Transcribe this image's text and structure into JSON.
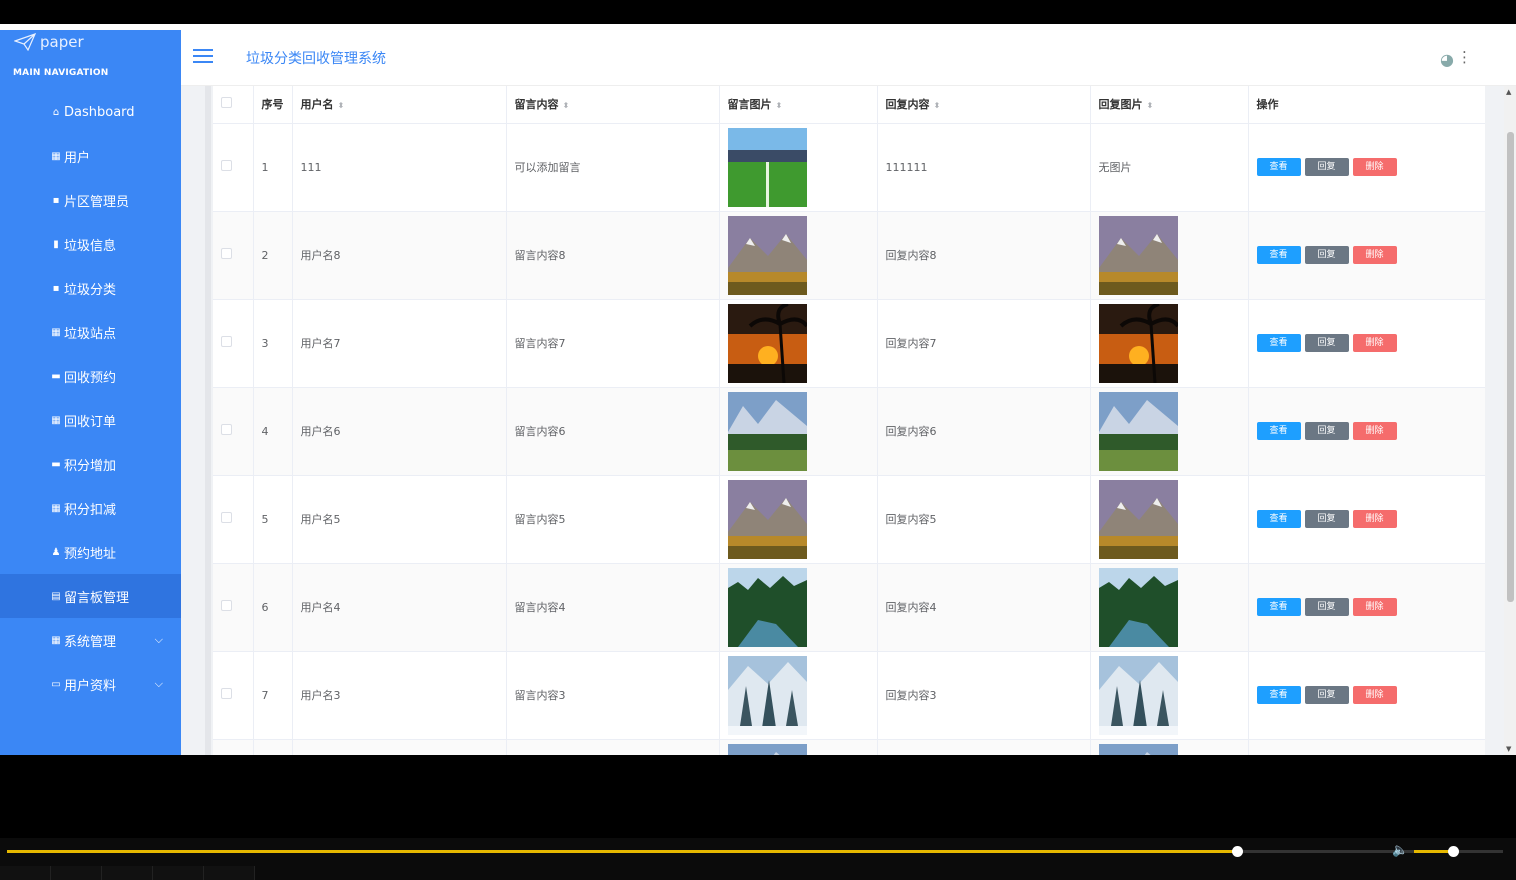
{
  "brand": {
    "name": "paper"
  },
  "sidebar": {
    "nav_title": "MAIN NAVIGATION",
    "items": [
      {
        "label": "Dashboard",
        "icon": "home-icon",
        "glyph": "⌂"
      },
      {
        "label": "用户",
        "icon": "grid-icon",
        "glyph": "▦"
      },
      {
        "label": "片区管理员",
        "icon": "comment-icon",
        "glyph": "▪"
      },
      {
        "label": "垃圾信息",
        "icon": "bar-chart-icon",
        "glyph": "▮"
      },
      {
        "label": "垃圾分类",
        "icon": "comment-icon",
        "glyph": "▪"
      },
      {
        "label": "垃圾站点",
        "icon": "grid-icon",
        "glyph": "▦"
      },
      {
        "label": "回收预约",
        "icon": "briefcase-icon",
        "glyph": "▬"
      },
      {
        "label": "回收订单",
        "icon": "grid-icon",
        "glyph": "▦"
      },
      {
        "label": "积分增加",
        "icon": "card-icon",
        "glyph": "▬"
      },
      {
        "label": "积分扣减",
        "icon": "grid-icon",
        "glyph": "▦"
      },
      {
        "label": "预约地址",
        "icon": "user-icon",
        "glyph": "♟"
      },
      {
        "label": "留言板管理",
        "icon": "clipboard-icon",
        "glyph": "▤"
      },
      {
        "label": "系统管理",
        "icon": "grid-icon",
        "glyph": "▦"
      },
      {
        "label": "用户资料",
        "icon": "calendar-icon",
        "glyph": "▭"
      }
    ],
    "active_index": 11
  },
  "header": {
    "title": "垃圾分类回收管理系统"
  },
  "table": {
    "columns": [
      "序号",
      "用户名",
      "留言内容",
      "留言图片",
      "回复内容",
      "回复图片",
      "操作"
    ],
    "rows": [
      {
        "no": "1",
        "user": "111",
        "message": "可以添加留言",
        "msg_img": "field",
        "reply": "111111",
        "reply_img": "none",
        "reply_text": "无图片"
      },
      {
        "no": "2",
        "user": "用户名8",
        "message": "留言内容8",
        "msg_img": "mountain-autumn",
        "reply": "回复内容8",
        "reply_img": "mountain-autumn",
        "reply_text": ""
      },
      {
        "no": "3",
        "user": "用户名7",
        "message": "留言内容7",
        "msg_img": "palm-sunset",
        "reply": "回复内容7",
        "reply_img": "palm-sunset",
        "reply_text": ""
      },
      {
        "no": "4",
        "user": "用户名6",
        "message": "留言内容6",
        "msg_img": "alpine-meadow",
        "reply": "回复内容6",
        "reply_img": "alpine-meadow",
        "reply_text": ""
      },
      {
        "no": "5",
        "user": "用户名5",
        "message": "留言内容5",
        "msg_img": "mountain-autumn",
        "reply": "回复内容5",
        "reply_img": "mountain-autumn",
        "reply_text": ""
      },
      {
        "no": "6",
        "user": "用户名4",
        "message": "留言内容4",
        "msg_img": "forest-river",
        "reply": "回复内容4",
        "reply_img": "forest-river",
        "reply_text": ""
      },
      {
        "no": "7",
        "user": "用户名3",
        "message": "留言内容3",
        "msg_img": "snow-trees",
        "reply": "回复内容3",
        "reply_img": "snow-trees",
        "reply_text": ""
      }
    ],
    "actions": {
      "view": "查看",
      "reply": "回复",
      "delete": "删除"
    }
  },
  "player": {
    "progress_fraction": 0.822,
    "volume_fraction": 0.44
  },
  "colors": {
    "sidebar": "#3b87f5",
    "active": "#2f74e0",
    "view": "#1e9fff",
    "reply": "#6b7784",
    "delete": "#f56c6c"
  }
}
